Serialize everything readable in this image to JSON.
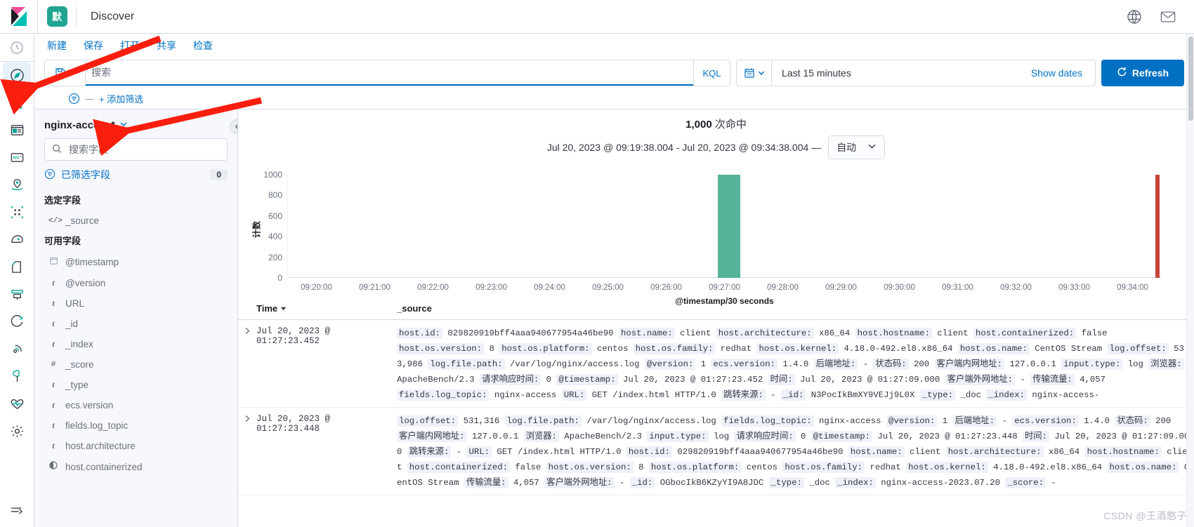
{
  "chrome": {
    "space_badge": "默",
    "app_title": "Discover",
    "icons": [
      {
        "name": "help-icon",
        "glyph": "?"
      },
      {
        "name": "mail-icon",
        "glyph": "✉"
      }
    ]
  },
  "rail": {
    "items": [
      {
        "name": "recently-viewed-icon",
        "label": "Recently viewed",
        "icon": "clock"
      },
      {
        "name": "discover-icon",
        "label": "Discover",
        "icon": "compass",
        "active": true
      },
      {
        "name": "visualize-icon",
        "label": "Visualize",
        "icon": "bar-chart"
      },
      {
        "name": "dashboard-icon",
        "label": "Dashboard",
        "icon": "dashboard"
      },
      {
        "name": "canvas-icon",
        "label": "Canvas",
        "icon": "canvas"
      },
      {
        "name": "maps-icon",
        "label": "Maps",
        "icon": "map-marker"
      },
      {
        "name": "graph-icon",
        "label": "Graph",
        "icon": "graph"
      },
      {
        "name": "ml-icon",
        "label": "Machine Learning",
        "icon": "ml"
      },
      {
        "name": "logs-icon",
        "label": "Logs",
        "icon": "logs"
      },
      {
        "name": "metrics-icon",
        "label": "Metrics",
        "icon": "metrics"
      },
      {
        "name": "apm-icon",
        "label": "APM",
        "icon": "apm"
      },
      {
        "name": "uptime-icon",
        "label": "Uptime",
        "icon": "uptime"
      },
      {
        "name": "devtools-icon",
        "label": "Dev Tools",
        "icon": "wrench"
      },
      {
        "name": "monitoring-icon",
        "label": "Stack Monitoring",
        "icon": "heartbeat"
      },
      {
        "name": "management-icon",
        "label": "Management",
        "icon": "gear"
      }
    ],
    "collapse": {
      "name": "collapse-nav-icon",
      "glyph": "⇥"
    }
  },
  "topnav": {
    "items": [
      {
        "name": "nav-new",
        "label": "新建"
      },
      {
        "name": "nav-save",
        "label": "保存"
      },
      {
        "name": "nav-open",
        "label": "打开"
      },
      {
        "name": "nav-share",
        "label": "共享"
      },
      {
        "name": "nav-inspect",
        "label": "检查"
      }
    ]
  },
  "querybar": {
    "search_placeholder": "搜索",
    "search_value": "",
    "language_label": "KQL",
    "time_range": "Last 15 minutes",
    "show_dates_label": "Show dates",
    "refresh_label": "Refresh"
  },
  "filterbar": {
    "add_filter_label": "+ 添加筛选",
    "dash": "—"
  },
  "fieldpanel": {
    "index_pattern": "nginx-access*",
    "search_placeholder": "搜索字段",
    "filtered_fields_label": "已筛选字段",
    "filtered_count": "0",
    "selected_title": "选定字段",
    "selected_fields": [
      {
        "name": "_source",
        "type": "source"
      }
    ],
    "available_title": "可用字段",
    "available_fields": [
      {
        "name": "@timestamp",
        "type": "date"
      },
      {
        "name": "@version",
        "type": "string"
      },
      {
        "name": "URL",
        "type": "string"
      },
      {
        "name": "_id",
        "type": "string"
      },
      {
        "name": "_index",
        "type": "string"
      },
      {
        "name": "_score",
        "type": "number"
      },
      {
        "name": "_type",
        "type": "string"
      },
      {
        "name": "ecs.version",
        "type": "string"
      },
      {
        "name": "fields.log_topic",
        "type": "string"
      },
      {
        "name": "host.architecture",
        "type": "string"
      },
      {
        "name": "host.containerized",
        "type": "boolean"
      }
    ]
  },
  "results": {
    "hits_count": "1,000",
    "hits_label": "次命中",
    "time_range_text": "Jul 20, 2023 @ 09:19:38.004 - Jul 20, 2023 @ 09:34:38.004 —",
    "interval_label": "自动",
    "table": {
      "columns": [
        {
          "name": "col-time",
          "label": "Time"
        },
        {
          "name": "col-source",
          "label": "_source"
        }
      ],
      "rows": [
        {
          "time": "Jul 20, 2023 @ 01:27:23.452",
          "pairs": [
            [
              "host.id:",
              "029820919bff4aaa940677954a46be90"
            ],
            [
              "host.name:",
              "client"
            ],
            [
              "host.architecture:",
              "x86_64"
            ],
            [
              "host.hostname:",
              "client"
            ],
            [
              "host.containerized:",
              "false"
            ],
            [
              "host.os.version:",
              "8"
            ],
            [
              "host.os.platform:",
              "centos"
            ],
            [
              "host.os.family:",
              "redhat"
            ],
            [
              "host.os.kernel:",
              "4.18.0-492.el8.x86_64"
            ],
            [
              "host.os.name:",
              "CentOS Stream"
            ],
            [
              "log.offset:",
              "533,986"
            ],
            [
              "log.file.path:",
              "/var/log/nginx/access.log"
            ],
            [
              "@version:",
              "1"
            ],
            [
              "ecs.version:",
              "1.4.0"
            ],
            [
              "后端地址:",
              "-"
            ],
            [
              "状态码:",
              "200"
            ],
            [
              "客户端内网地址:",
              "127.0.0.1"
            ],
            [
              "input.type:",
              "log"
            ],
            [
              "浏览器:",
              "ApacheBench/2.3"
            ],
            [
              "请求响应时间:",
              "0"
            ],
            [
              "@timestamp:",
              "Jul 20, 2023 @ 01:27:23.452"
            ],
            [
              "时间:",
              "Jul 20, 2023 @ 01:27:09.000"
            ],
            [
              "客户端外网地址:",
              "-"
            ],
            [
              "传输流量:",
              "4,057"
            ],
            [
              "fields.log_topic:",
              "nginx-access"
            ],
            [
              "URL:",
              "GET /index.html HTTP/1.0"
            ],
            [
              "跳转来源:",
              "-"
            ],
            [
              "_id:",
              "N3PocIkBmXY9VEJj9L0X"
            ],
            [
              "_type:",
              "_doc"
            ],
            [
              "_index:",
              "nginx-access-"
            ]
          ]
        },
        {
          "time": "Jul 20, 2023 @ 01:27:23.448",
          "pairs": [
            [
              "log.offset:",
              "531,316"
            ],
            [
              "log.file.path:",
              "/var/log/nginx/access.log"
            ],
            [
              "fields.log_topic:",
              "nginx-access"
            ],
            [
              "@version:",
              "1"
            ],
            [
              "后端地址:",
              "-"
            ],
            [
              "ecs.version:",
              "1.4.0"
            ],
            [
              "状态码:",
              "200"
            ],
            [
              "客户端内网地址:",
              "127.0.0.1"
            ],
            [
              "浏览器:",
              "ApacheBench/2.3"
            ],
            [
              "input.type:",
              "log"
            ],
            [
              "请求响应时间:",
              "0"
            ],
            [
              "@timestamp:",
              "Jul 20, 2023 @ 01:27:23.448"
            ],
            [
              "时间:",
              "Jul 20, 2023 @ 01:27:09.000"
            ],
            [
              "跳转来源:",
              "-"
            ],
            [
              "URL:",
              "GET /index.html HTTP/1.0"
            ],
            [
              "host.id:",
              "029820919bff4aaa940677954a46be90"
            ],
            [
              "host.name:",
              "client"
            ],
            [
              "host.architecture:",
              "x86_64"
            ],
            [
              "host.hostname:",
              "client"
            ],
            [
              "host.containerized:",
              "false"
            ],
            [
              "host.os.version:",
              "8"
            ],
            [
              "host.os.platform:",
              "centos"
            ],
            [
              "host.os.family:",
              "redhat"
            ],
            [
              "host.os.kernel:",
              "4.18.0-492.el8.x86_64"
            ],
            [
              "host.os.name:",
              "CentOS Stream"
            ],
            [
              "传输流量:",
              "4,057"
            ],
            [
              "客户端外网地址:",
              "-"
            ],
            [
              "_id:",
              "OGbocIkB6KZyYI9A8JDC"
            ],
            [
              "_type:",
              "_doc"
            ],
            [
              "_index:",
              "nginx-access-2023.07.20"
            ],
            [
              "_score:",
              "-"
            ]
          ]
        }
      ]
    }
  },
  "chart_data": {
    "type": "bar",
    "title": "",
    "xlabel": "@timestamp/30 seconds",
    "ylabel": "计数",
    "ylim": [
      0,
      1000
    ],
    "yticks": [
      0,
      200,
      400,
      600,
      800,
      1000
    ],
    "grid": false,
    "legend": null,
    "bar_color": "#54b399",
    "x_tick_labels": [
      "09:20:00",
      "09:21:00",
      "09:22:00",
      "09:23:00",
      "09:24:00",
      "09:25:00",
      "09:26:00",
      "09:27:00",
      "09:28:00",
      "09:29:00",
      "09:30:00",
      "09:31:00",
      "09:32:00",
      "09:33:00",
      "09:34:00"
    ],
    "categories": [
      "09:27:00",
      "09:34:30"
    ],
    "values": [
      1000,
      1000
    ],
    "series": [
      {
        "name": "Count",
        "values": [
          1000,
          1000
        ]
      }
    ],
    "annotations": [
      "1,000 次命中",
      "Jul 20, 2023 @ 09:19:38.004 - Jul 20, 2023 @ 09:34:38.004"
    ]
  },
  "watermark": "CSDN @王酒憨子"
}
